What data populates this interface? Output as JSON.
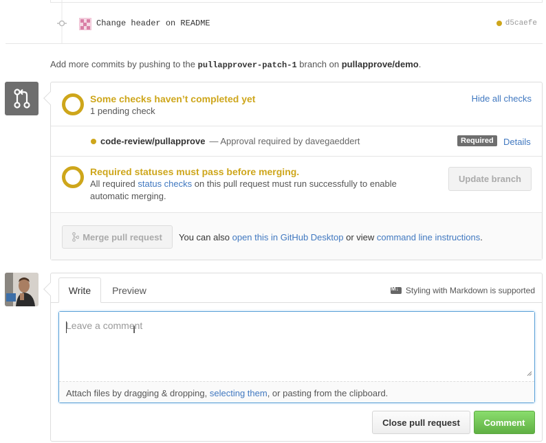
{
  "commit": {
    "message": "Change header on README",
    "sha": "d5caefe",
    "status_color": "#cea61b"
  },
  "push_note": {
    "prefix": "Add more commits by pushing to the",
    "branch": "pullapprover-patch-1",
    "middle": "branch on",
    "repo": "pullapprove/demo",
    "suffix": "."
  },
  "merge": {
    "checks_title": "Some checks haven’t completed yet",
    "checks_sub": "1 pending check",
    "hide_checks": "Hide all checks",
    "check_name": "code-review/pullapprove",
    "check_desc": "— Approval required by davegaeddert",
    "required_badge": "Required",
    "details_link": "Details",
    "required_title": "Required statuses must pass before merging.",
    "required_sub_1": "All required",
    "required_sub_link": "status checks",
    "required_sub_2": "on this pull request must run successfully to enable",
    "required_sub_3": "automatic merging.",
    "update_branch": "Update branch",
    "merge_button": "Merge pull request",
    "also_text": "You can also",
    "desktop_link": "open this in GitHub Desktop",
    "or_view": "or view",
    "cli_link": "command line instructions",
    "period": ".",
    "warn_color": "#cea61b"
  },
  "comment": {
    "tab_write": "Write",
    "tab_preview": "Preview",
    "markdown_note": "Styling with Markdown is supported",
    "placeholder": "Leave a comment",
    "attach_1": "Attach files by dragging & dropping,",
    "attach_link": "selecting them",
    "attach_2": ", or pasting from the clipboard.",
    "close_button": "Close pull request",
    "comment_button": "Comment"
  }
}
